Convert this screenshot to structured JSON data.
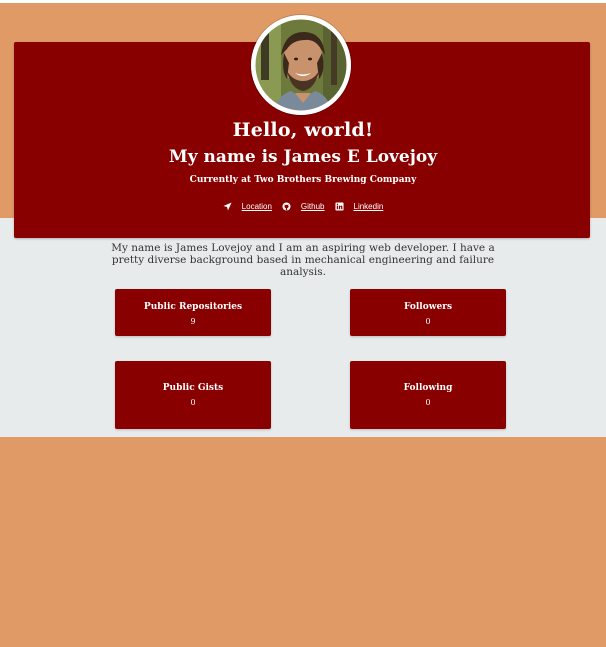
{
  "colors": {
    "page_background": "#e09a66",
    "band_background": "#e8ebec",
    "card_background": "#880000",
    "card_text": "#ffffff",
    "bio_text": "#333333"
  },
  "profile": {
    "greeting": "Hello, world!",
    "name": "My name is James E Lovejoy",
    "employment": "Currently at Two Brothers Brewing Company",
    "avatar_icon": "profile-photo"
  },
  "links": [
    {
      "icon": "location-arrow-icon",
      "label": "Location"
    },
    {
      "icon": "github-icon",
      "label": "Github"
    },
    {
      "icon": "linkedin-icon",
      "label": "Linkedin"
    }
  ],
  "bio": "My name is James Lovejoy and I am an aspiring web developer. I have a pretty diverse background based in mechanical engineering and failure analysis.",
  "stats": {
    "public_repos": {
      "label": "Public Repositories",
      "value": "9"
    },
    "followers": {
      "label": "Followers",
      "value": "0"
    },
    "public_gists": {
      "label": "Public Gists",
      "value": "0"
    },
    "following": {
      "label": "Following",
      "value": "0"
    }
  }
}
